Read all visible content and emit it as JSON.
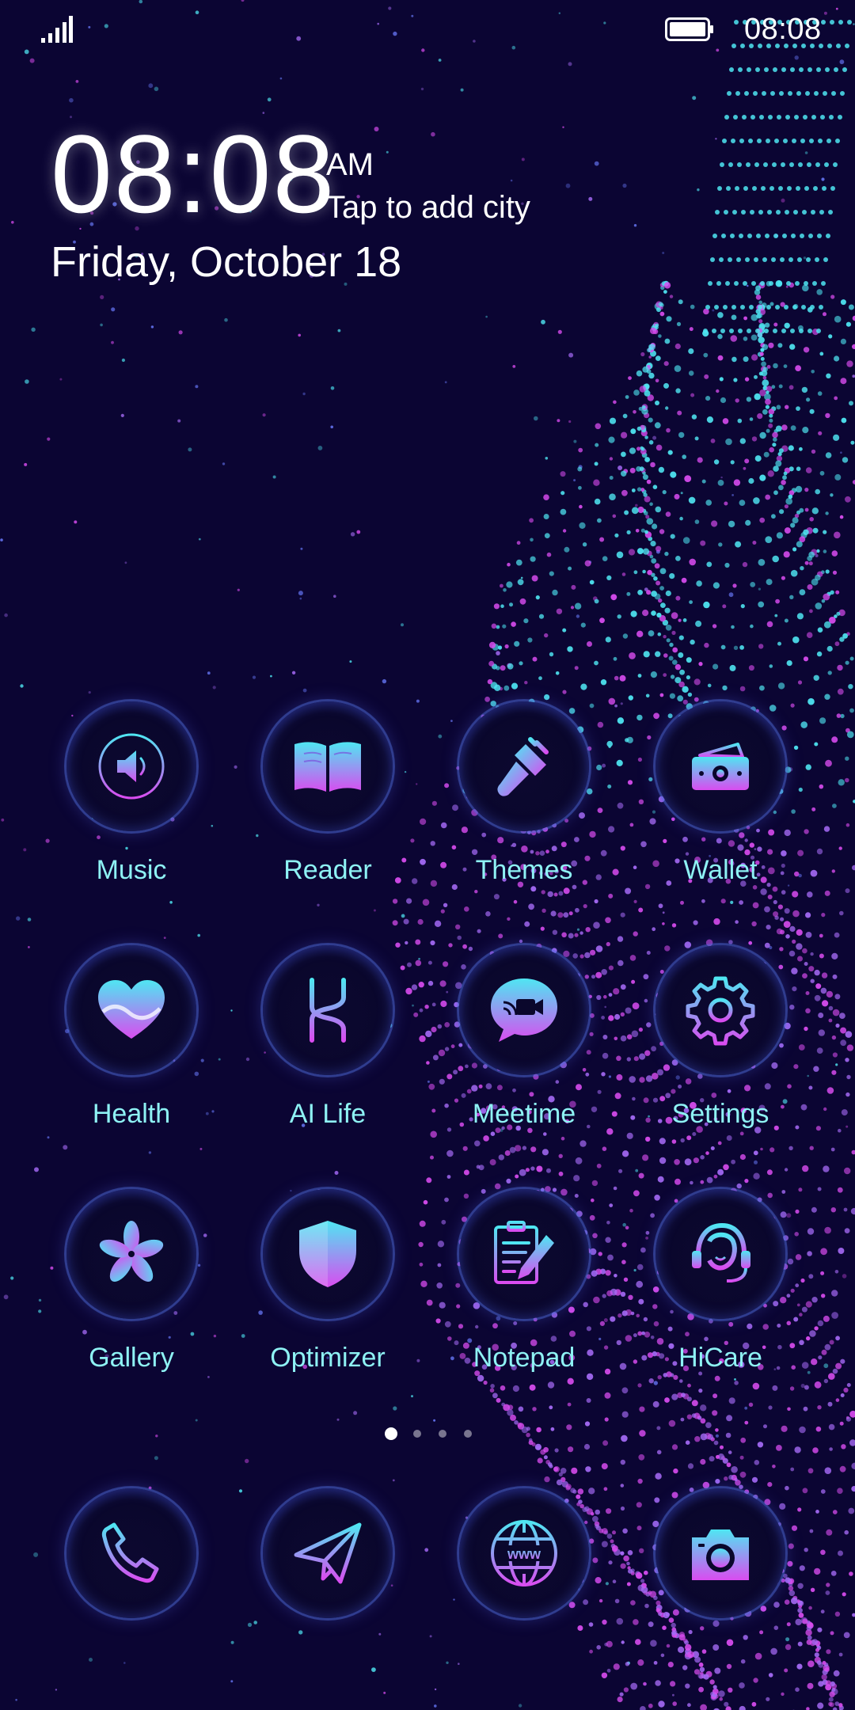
{
  "status_bar": {
    "time": "08:08"
  },
  "clock_widget": {
    "time": "08:08",
    "ampm": "AM",
    "city_prompt": "Tap to add city",
    "date": "Friday, October 18"
  },
  "apps": [
    {
      "label": "Music",
      "icon": "speaker-icon"
    },
    {
      "label": "Reader",
      "icon": "book-icon"
    },
    {
      "label": "Themes",
      "icon": "brush-icon"
    },
    {
      "label": "Wallet",
      "icon": "wallet-icon"
    },
    {
      "label": "Health",
      "icon": "heart-icon"
    },
    {
      "label": "AI Life",
      "icon": "ai-life-icon"
    },
    {
      "label": "Meetime",
      "icon": "video-chat-icon"
    },
    {
      "label": "Settings",
      "icon": "gear-icon"
    },
    {
      "label": "Gallery",
      "icon": "flower-icon"
    },
    {
      "label": "Optimizer",
      "icon": "shield-icon"
    },
    {
      "label": "Notepad",
      "icon": "clipboard-pen-icon"
    },
    {
      "label": "HiCare",
      "icon": "headset-icon"
    }
  ],
  "page_indicator": {
    "pages": 4,
    "current": 1
  },
  "dock": [
    {
      "icon": "phone-icon"
    },
    {
      "icon": "paper-plane-icon"
    },
    {
      "icon": "globe-www-icon",
      "text": "www"
    },
    {
      "icon": "camera-icon"
    }
  ],
  "colors": {
    "background": "#0b0533",
    "label": "#8ef2f4",
    "gradient_cyan": "#4fe6f2",
    "gradient_magenta": "#d94cf0"
  }
}
